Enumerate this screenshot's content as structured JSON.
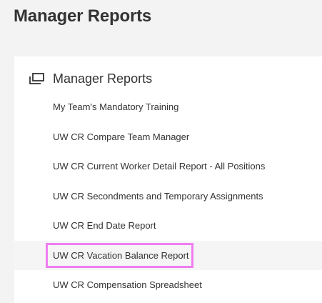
{
  "page": {
    "title": "Manager Reports"
  },
  "card": {
    "title": "Manager Reports",
    "icon": "report-group-icon",
    "items": [
      {
        "label": "My Team's Mandatory Training"
      },
      {
        "label": "UW CR Compare Team Manager"
      },
      {
        "label": "UW CR Current Worker Detail Report - All Positions"
      },
      {
        "label": "UW CR Secondments and Temporary Assignments"
      },
      {
        "label": "UW CR End Date Report"
      },
      {
        "label": "UW CR Vacation Balance Report"
      },
      {
        "label": "UW CR Compensation Spreadsheet"
      }
    ]
  },
  "colors": {
    "background": "#f3f3f3",
    "card": "#ffffff",
    "highlight_border": "#f07df0",
    "hover_row": "#f5f5f5",
    "text": "#333333"
  }
}
